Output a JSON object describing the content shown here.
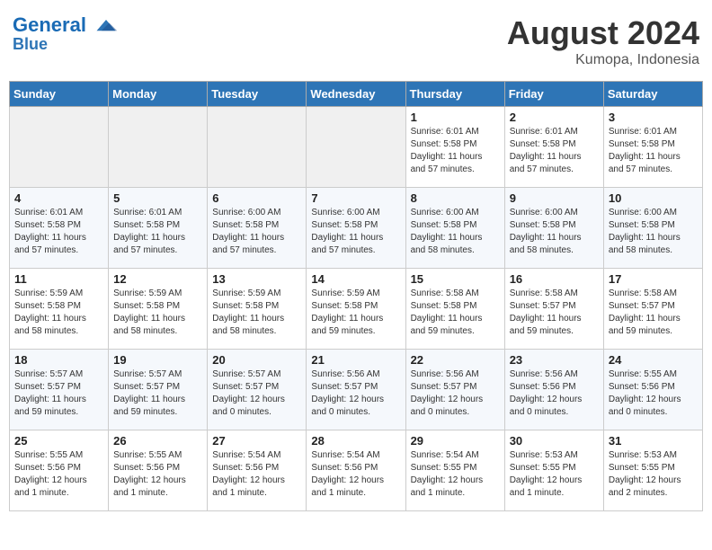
{
  "header": {
    "logo_line1": "General",
    "logo_line2": "Blue",
    "month_year": "August 2024",
    "location": "Kumopa, Indonesia"
  },
  "weekdays": [
    "Sunday",
    "Monday",
    "Tuesday",
    "Wednesday",
    "Thursday",
    "Friday",
    "Saturday"
  ],
  "weeks": [
    [
      {
        "day": "",
        "sunrise": "",
        "sunset": "",
        "daylight": "",
        "empty": true
      },
      {
        "day": "",
        "sunrise": "",
        "sunset": "",
        "daylight": "",
        "empty": true
      },
      {
        "day": "",
        "sunrise": "",
        "sunset": "",
        "daylight": "",
        "empty": true
      },
      {
        "day": "",
        "sunrise": "",
        "sunset": "",
        "daylight": "",
        "empty": true
      },
      {
        "day": "1",
        "sunrise": "Sunrise: 6:01 AM",
        "sunset": "Sunset: 5:58 PM",
        "daylight": "Daylight: 11 hours and 57 minutes.",
        "empty": false
      },
      {
        "day": "2",
        "sunrise": "Sunrise: 6:01 AM",
        "sunset": "Sunset: 5:58 PM",
        "daylight": "Daylight: 11 hours and 57 minutes.",
        "empty": false
      },
      {
        "day": "3",
        "sunrise": "Sunrise: 6:01 AM",
        "sunset": "Sunset: 5:58 PM",
        "daylight": "Daylight: 11 hours and 57 minutes.",
        "empty": false
      }
    ],
    [
      {
        "day": "4",
        "sunrise": "Sunrise: 6:01 AM",
        "sunset": "Sunset: 5:58 PM",
        "daylight": "Daylight: 11 hours and 57 minutes.",
        "empty": false
      },
      {
        "day": "5",
        "sunrise": "Sunrise: 6:01 AM",
        "sunset": "Sunset: 5:58 PM",
        "daylight": "Daylight: 11 hours and 57 minutes.",
        "empty": false
      },
      {
        "day": "6",
        "sunrise": "Sunrise: 6:00 AM",
        "sunset": "Sunset: 5:58 PM",
        "daylight": "Daylight: 11 hours and 57 minutes.",
        "empty": false
      },
      {
        "day": "7",
        "sunrise": "Sunrise: 6:00 AM",
        "sunset": "Sunset: 5:58 PM",
        "daylight": "Daylight: 11 hours and 57 minutes.",
        "empty": false
      },
      {
        "day": "8",
        "sunrise": "Sunrise: 6:00 AM",
        "sunset": "Sunset: 5:58 PM",
        "daylight": "Daylight: 11 hours and 58 minutes.",
        "empty": false
      },
      {
        "day": "9",
        "sunrise": "Sunrise: 6:00 AM",
        "sunset": "Sunset: 5:58 PM",
        "daylight": "Daylight: 11 hours and 58 minutes.",
        "empty": false
      },
      {
        "day": "10",
        "sunrise": "Sunrise: 6:00 AM",
        "sunset": "Sunset: 5:58 PM",
        "daylight": "Daylight: 11 hours and 58 minutes.",
        "empty": false
      }
    ],
    [
      {
        "day": "11",
        "sunrise": "Sunrise: 5:59 AM",
        "sunset": "Sunset: 5:58 PM",
        "daylight": "Daylight: 11 hours and 58 minutes.",
        "empty": false
      },
      {
        "day": "12",
        "sunrise": "Sunrise: 5:59 AM",
        "sunset": "Sunset: 5:58 PM",
        "daylight": "Daylight: 11 hours and 58 minutes.",
        "empty": false
      },
      {
        "day": "13",
        "sunrise": "Sunrise: 5:59 AM",
        "sunset": "Sunset: 5:58 PM",
        "daylight": "Daylight: 11 hours and 58 minutes.",
        "empty": false
      },
      {
        "day": "14",
        "sunrise": "Sunrise: 5:59 AM",
        "sunset": "Sunset: 5:58 PM",
        "daylight": "Daylight: 11 hours and 59 minutes.",
        "empty": false
      },
      {
        "day": "15",
        "sunrise": "Sunrise: 5:58 AM",
        "sunset": "Sunset: 5:58 PM",
        "daylight": "Daylight: 11 hours and 59 minutes.",
        "empty": false
      },
      {
        "day": "16",
        "sunrise": "Sunrise: 5:58 AM",
        "sunset": "Sunset: 5:57 PM",
        "daylight": "Daylight: 11 hours and 59 minutes.",
        "empty": false
      },
      {
        "day": "17",
        "sunrise": "Sunrise: 5:58 AM",
        "sunset": "Sunset: 5:57 PM",
        "daylight": "Daylight: 11 hours and 59 minutes.",
        "empty": false
      }
    ],
    [
      {
        "day": "18",
        "sunrise": "Sunrise: 5:57 AM",
        "sunset": "Sunset: 5:57 PM",
        "daylight": "Daylight: 11 hours and 59 minutes.",
        "empty": false
      },
      {
        "day": "19",
        "sunrise": "Sunrise: 5:57 AM",
        "sunset": "Sunset: 5:57 PM",
        "daylight": "Daylight: 11 hours and 59 minutes.",
        "empty": false
      },
      {
        "day": "20",
        "sunrise": "Sunrise: 5:57 AM",
        "sunset": "Sunset: 5:57 PM",
        "daylight": "Daylight: 12 hours and 0 minutes.",
        "empty": false
      },
      {
        "day": "21",
        "sunrise": "Sunrise: 5:56 AM",
        "sunset": "Sunset: 5:57 PM",
        "daylight": "Daylight: 12 hours and 0 minutes.",
        "empty": false
      },
      {
        "day": "22",
        "sunrise": "Sunrise: 5:56 AM",
        "sunset": "Sunset: 5:57 PM",
        "daylight": "Daylight: 12 hours and 0 minutes.",
        "empty": false
      },
      {
        "day": "23",
        "sunrise": "Sunrise: 5:56 AM",
        "sunset": "Sunset: 5:56 PM",
        "daylight": "Daylight: 12 hours and 0 minutes.",
        "empty": false
      },
      {
        "day": "24",
        "sunrise": "Sunrise: 5:55 AM",
        "sunset": "Sunset: 5:56 PM",
        "daylight": "Daylight: 12 hours and 0 minutes.",
        "empty": false
      }
    ],
    [
      {
        "day": "25",
        "sunrise": "Sunrise: 5:55 AM",
        "sunset": "Sunset: 5:56 PM",
        "daylight": "Daylight: 12 hours and 1 minute.",
        "empty": false
      },
      {
        "day": "26",
        "sunrise": "Sunrise: 5:55 AM",
        "sunset": "Sunset: 5:56 PM",
        "daylight": "Daylight: 12 hours and 1 minute.",
        "empty": false
      },
      {
        "day": "27",
        "sunrise": "Sunrise: 5:54 AM",
        "sunset": "Sunset: 5:56 PM",
        "daylight": "Daylight: 12 hours and 1 minute.",
        "empty": false
      },
      {
        "day": "28",
        "sunrise": "Sunrise: 5:54 AM",
        "sunset": "Sunset: 5:56 PM",
        "daylight": "Daylight: 12 hours and 1 minute.",
        "empty": false
      },
      {
        "day": "29",
        "sunrise": "Sunrise: 5:54 AM",
        "sunset": "Sunset: 5:55 PM",
        "daylight": "Daylight: 12 hours and 1 minute.",
        "empty": false
      },
      {
        "day": "30",
        "sunrise": "Sunrise: 5:53 AM",
        "sunset": "Sunset: 5:55 PM",
        "daylight": "Daylight: 12 hours and 1 minute.",
        "empty": false
      },
      {
        "day": "31",
        "sunrise": "Sunrise: 5:53 AM",
        "sunset": "Sunset: 5:55 PM",
        "daylight": "Daylight: 12 hours and 2 minutes.",
        "empty": false
      }
    ]
  ]
}
